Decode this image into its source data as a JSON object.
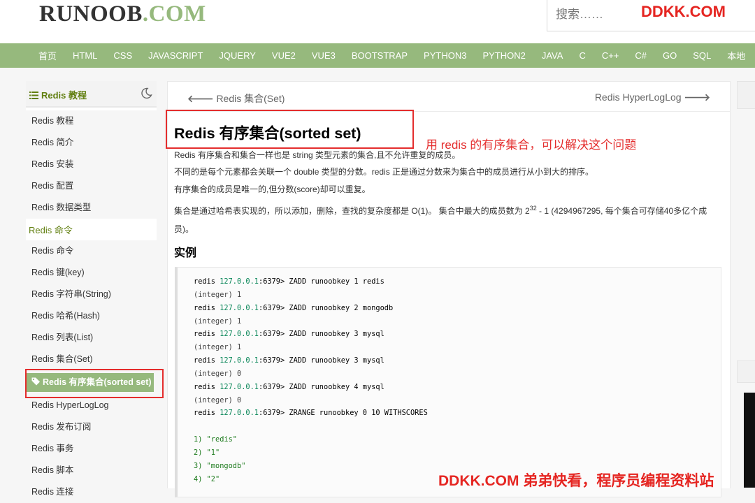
{
  "header": {
    "logo_main": "RUNOOB",
    "logo_suffix": ".COM",
    "search_placeholder": "搜索……",
    "watermark": "DDKK.COM"
  },
  "nav": {
    "items": [
      "首页",
      "HTML",
      "CSS",
      "JAVASCRIPT",
      "JQUERY",
      "VUE2",
      "VUE3",
      "BOOTSTRAP",
      "PYTHON3",
      "PYTHON2",
      "JAVA",
      "C",
      "C++",
      "C#",
      "GO",
      "SQL",
      "本地"
    ]
  },
  "sidebar": {
    "title": "Redis 教程",
    "group1": [
      "Redis 教程",
      "Redis 简介",
      "Redis 安装",
      "Redis 配置",
      "Redis 数据类型"
    ],
    "section2": "Redis 命令",
    "group2": [
      "Redis 命令",
      "Redis 键(key)",
      "Redis 字符串(String)",
      "Redis 哈希(Hash)",
      "Redis 列表(List)",
      "Redis 集合(Set)"
    ],
    "active": "Redis 有序集合(sorted set)",
    "group3": [
      "Redis HyperLogLog",
      "Redis 发布订阅",
      "Redis 事务",
      "Redis 脚本",
      "Redis 连接"
    ]
  },
  "main": {
    "prev": "Redis 集合(Set)",
    "next": "Redis HyperLogLog",
    "title": "Redis 有序集合(sorted set)",
    "annotation": "用 redis 的有序集合，可以解决这个问题",
    "p1": "Redis 有序集合和集合一样也是 string 类型元素的集合,且不允许重复的成员。",
    "p2": "不同的是每个元素都会关联一个 double 类型的分数。redis 正是通过分数来为集合中的成员进行从小到大的排序。",
    "p3": "有序集合的成员是唯一的,但分数(score)却可以重复。",
    "p4_before": "集合是通过哈希表实现的，所以添加，删除，查找的复杂度都是 O(1)。 集合中最大的成员数为 2",
    "p4_sup": "32",
    "p4_after": " - 1 (4294967295, 每个集合可存储40多亿个成员)。",
    "section": "实例",
    "prompt_prefix": "redis ",
    "host": "127.0.0.1",
    "port": ":6379> ",
    "cmd1": "ZADD runoobkey 1 redis",
    "res1": "(integer) 1",
    "cmd2": "ZADD runoobkey 2 mongodb",
    "res2": "(integer) 1",
    "cmd3": "ZADD runoobkey 3 mysql",
    "res3": "(integer) 1",
    "cmd4": "ZADD runoobkey 3 mysql",
    "res4": "(integer) 0",
    "cmd5": "ZADD runoobkey 4 mysql",
    "res5": "(integer) 0",
    "cmd6": "ZRANGE runoobkey 0 10 WITHSCORES",
    "out1": "1) \"redis\"",
    "out2": "2) \"1\"",
    "out3": "3) \"mongodb\"",
    "out4": "4) \"2\""
  },
  "watermark_bottom": "DDKK.COM 弟弟快看，程序员编程资料站"
}
